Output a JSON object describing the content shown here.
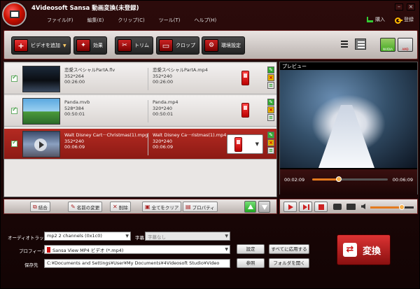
{
  "window": {
    "title": "4Videosoft Sansa 動画変換(未登録)"
  },
  "menu": {
    "items": [
      "ファイル(F)",
      "編集(E)",
      "クリップ(C)",
      "ツール(T)",
      "ヘルプ(H)"
    ]
  },
  "right_menu": {
    "buy": "購入",
    "register": "登録"
  },
  "toolbar": {
    "add_video": "ビデオを追加",
    "effect": "効果",
    "trim": "トリム",
    "crop": "クロップ",
    "preferences": "環境設定",
    "nvidia": "NVIDIA",
    "amd": "AMD"
  },
  "files": [
    {
      "name": "恋愛スペシャルPartA.flv",
      "res": "352*264",
      "dur": "00:26:00",
      "out_name": "恋愛スペシャルPartA.mp4",
      "out_res": "352*240",
      "out_dur": "00:26:00"
    },
    {
      "name": "Panda.mvb",
      "res": "528*384",
      "dur": "00:50:01",
      "out_name": "Panda.mp4",
      "out_res": "320*240",
      "out_dur": "00:50:01"
    },
    {
      "name": "Walt Disney Cart···Christmas(1).mpg",
      "res": "352*240",
      "dur": "00:06:09",
      "out_name": "Walt Disney Ca···ristmas(1).mp4",
      "out_res": "320*240",
      "out_dur": "00:06:09"
    }
  ],
  "list_actions": {
    "merge": "結合",
    "rename": "名前の変更",
    "delete": "削除",
    "clear_all": "全てをクリア",
    "properties": "プロパティ"
  },
  "preview": {
    "label": "プレビュー",
    "current_time": "00:02:09",
    "total_time": "00:06:09",
    "progress": 0.35,
    "volume": 0.72
  },
  "settings": {
    "audio_track_label": "オーディオトラック",
    "audio_track_value": "mp2 2 channels (0x1c0)",
    "subtitle_label": "字幕",
    "subtitle_value": "字幕なし",
    "profile_label": "プロフィール",
    "profile_value": "Sansa View MP4 ビデオ (*.mp4)",
    "settings_button": "設定",
    "apply_all_button": "すべてに応用する",
    "destination_label": "保存先",
    "destination_value": "C:¥Documents and Settings¥User¥My Documents¥4Videosoft Studio¥Video",
    "browse_button": "参照",
    "open_folder_button": "フォルダを開く",
    "convert_button": "変換"
  }
}
